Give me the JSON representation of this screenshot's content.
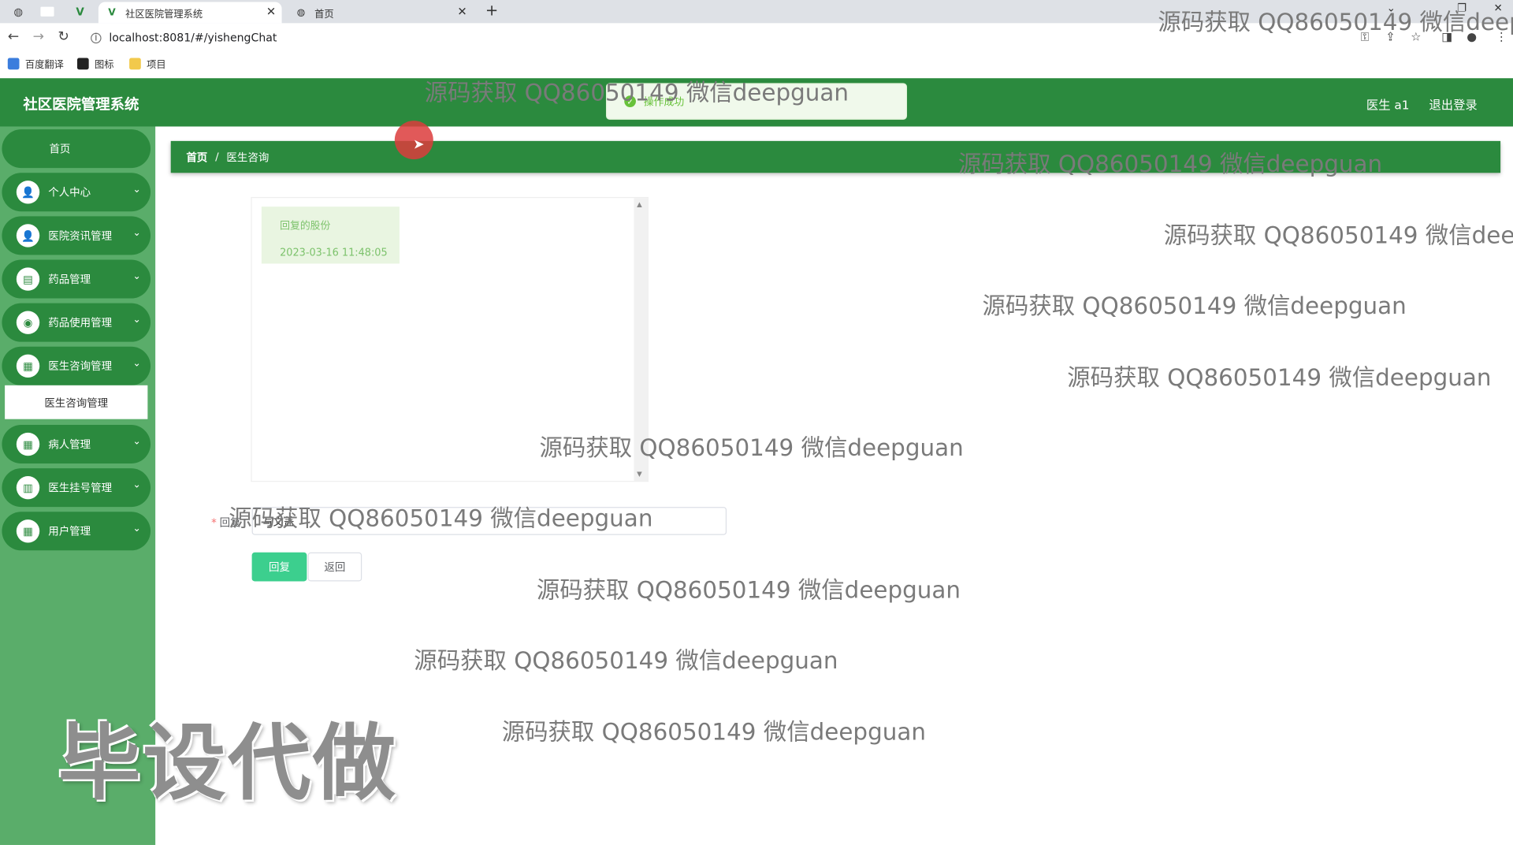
{
  "browser": {
    "tabs": [
      {
        "title": "社区医院管理系统",
        "active": true
      },
      {
        "title": "首页",
        "active": false
      }
    ],
    "url": "localhost:8081/#/yishengChat",
    "bookmarks": [
      "百度翻译",
      "图标",
      "项目"
    ]
  },
  "header": {
    "title": "社区医院管理系统",
    "user": "医生 a1",
    "logout": "退出登录"
  },
  "toast": {
    "message": "操作成功"
  },
  "sidebar": {
    "home": "首页",
    "items": [
      {
        "label": "个人中心",
        "icon": "user-icon"
      },
      {
        "label": "医院资讯管理",
        "icon": "user-icon"
      },
      {
        "label": "药品管理",
        "icon": "briefcase-icon"
      },
      {
        "label": "药品使用管理",
        "icon": "location-icon"
      },
      {
        "label": "医生咨询管理",
        "icon": "grid-icon"
      },
      {
        "label": "病人管理",
        "icon": "grid-icon"
      },
      {
        "label": "医生挂号管理",
        "icon": "clipboard-icon"
      },
      {
        "label": "用户管理",
        "icon": "grid-icon"
      }
    ],
    "submenu": "医生咨询管理"
  },
  "breadcrumb": {
    "home": "首页",
    "separator": "/",
    "current": "医生咨询"
  },
  "chat": {
    "messages": [
      {
        "text": "回复的股份",
        "time": "2023-03-16 11:48:05"
      }
    ]
  },
  "form": {
    "reply_label": "回复",
    "reply_value": "写文盖",
    "submit": "回复",
    "back": "返回"
  },
  "watermarks": {
    "text": "源码获取 QQ86050149 微信deepguan",
    "text_cut1": "源码获取 QQ86050149 微信deep",
    "text_cut2": "源码获取 QQ86050149 微信dee",
    "big": "毕设代做"
  }
}
